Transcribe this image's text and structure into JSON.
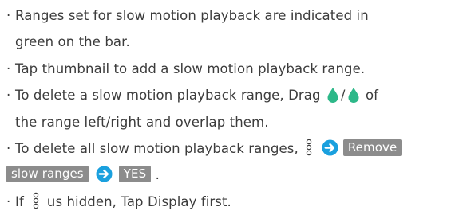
{
  "bullet": "·",
  "colors": {
    "text": "#3c3c3c",
    "accent_blue": "#1aa0de",
    "handle_green": "#2db889",
    "key_bg": "#8c8c8c"
  },
  "notes": {
    "n1_line1": "Ranges set for slow motion playback are indicated in",
    "n1_line2": "green on the bar.",
    "n2": "Tap thumbnail to add a slow motion playback range.",
    "n3_part1": "To delete a slow motion playback range, Drag",
    "n3_slash": "/",
    "n3_part2": "of",
    "n3_line2": "the range left/right and overlap them.",
    "n4_part1": "To delete all slow motion playback ranges,",
    "n4_key1_line1": "Remove",
    "n4_key1_line2": "slow ranges",
    "n4_key2": "YES",
    "n4_end": ".",
    "n5_part1": "If",
    "n5_part2": "us hidden, Tap Display first."
  },
  "icons": {
    "handle": "green-pin-handle-icon",
    "arrow": "blue-circle-arrow-icon",
    "menu": "vertical-menu-icon"
  }
}
